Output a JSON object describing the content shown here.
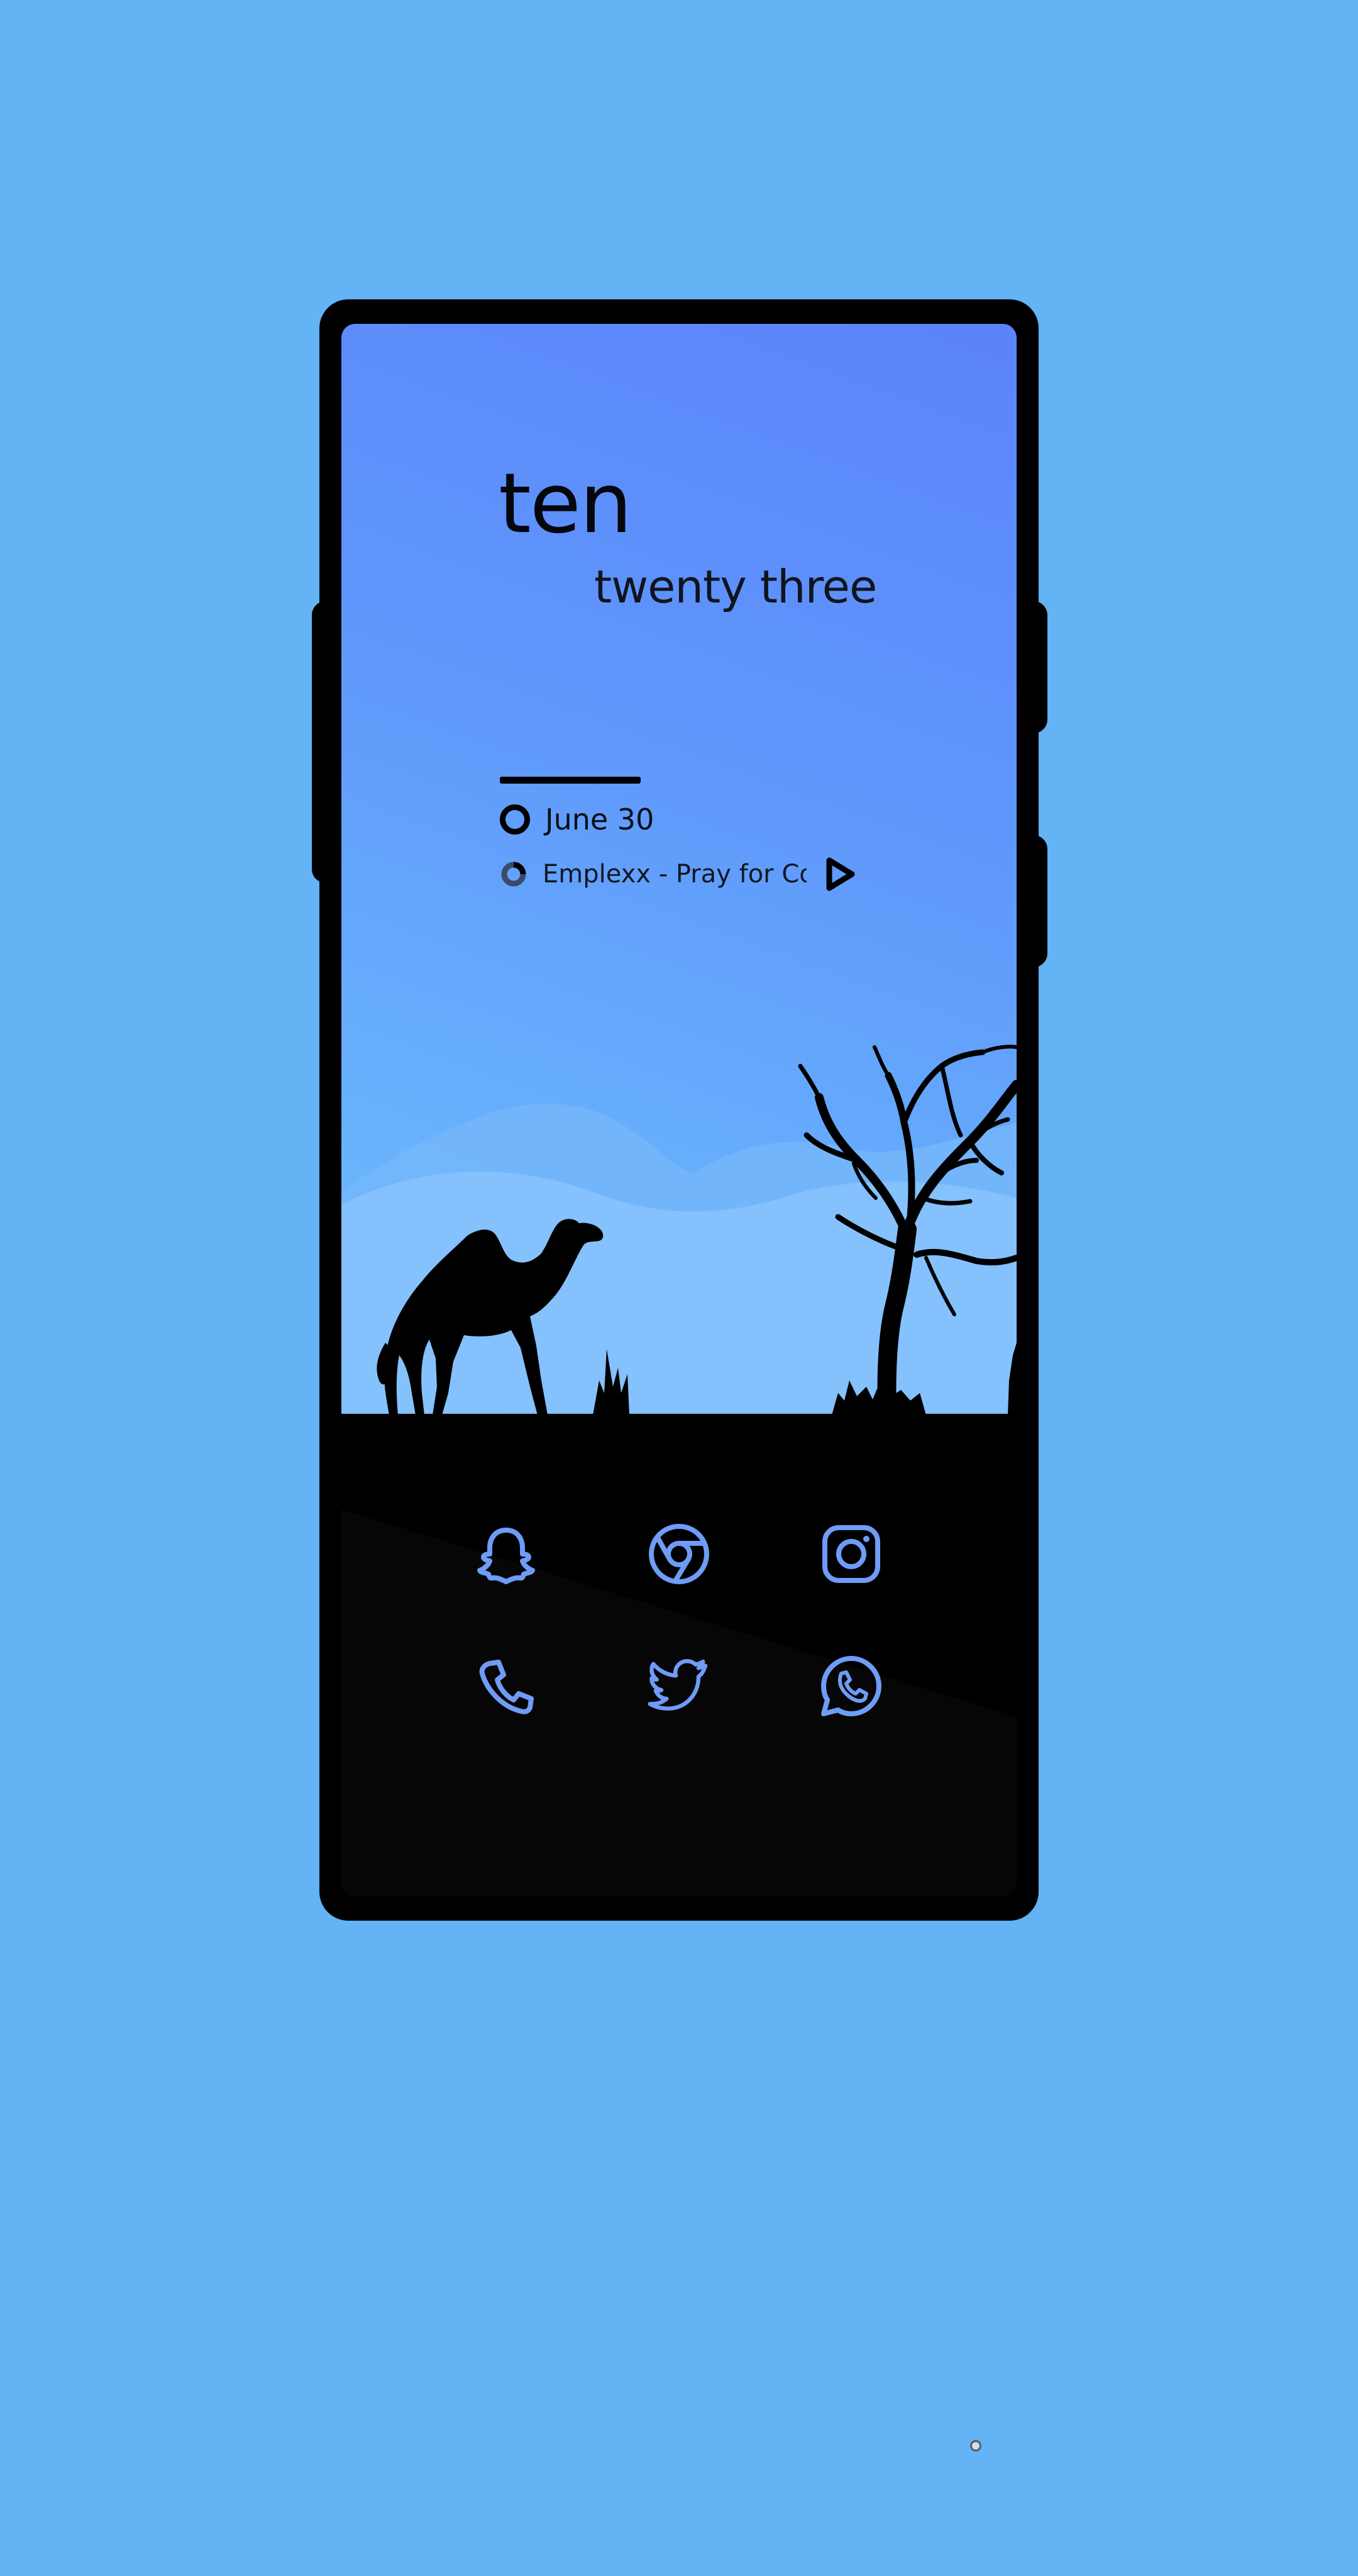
{
  "background_color": "#63b3f5",
  "accent_color": "#5b83fb",
  "icon_color": "#6e9cf6",
  "clock": {
    "hour_text": "ten",
    "minute_text": "twenty three"
  },
  "date": {
    "text": "June 30",
    "icon": "ring-icon"
  },
  "music": {
    "track": "Emplexx - Pray for Co...",
    "progress_icon": "progress-ring-icon",
    "play_icon": "play-icon"
  },
  "wallpaper": {
    "elements": [
      "camel-silhouette",
      "bare-tree-silhouette",
      "grass-tufts",
      "clouds"
    ]
  },
  "dock_apps": [
    {
      "name": "Snapchat",
      "icon": "snapchat-icon"
    },
    {
      "name": "Chrome",
      "icon": "chrome-icon"
    },
    {
      "name": "Instagram",
      "icon": "instagram-icon"
    },
    {
      "name": "Phone",
      "icon": "phone-icon"
    },
    {
      "name": "Twitter",
      "icon": "twitter-icon"
    },
    {
      "name": "WhatsApp",
      "icon": "whatsapp-icon"
    }
  ]
}
